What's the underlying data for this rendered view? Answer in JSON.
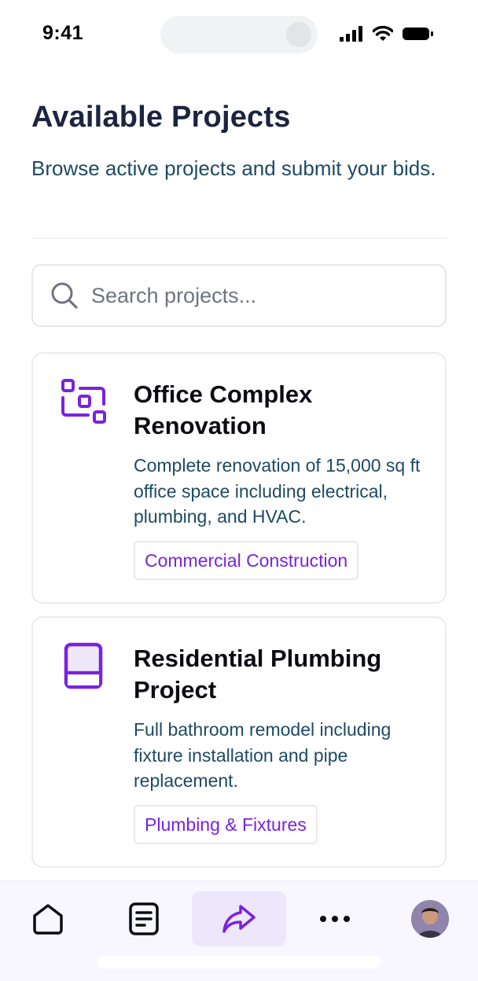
{
  "status_bar": {
    "time": "9:41"
  },
  "header": {
    "title": "Available Projects",
    "subtitle": "Browse active projects and submit your bids."
  },
  "search": {
    "placeholder": "Search projects...",
    "value": ""
  },
  "projects": [
    {
      "title": "Office Complex Renovation",
      "description": "Complete renovation of 15,000 sq ft office space including electrical, plumbing, and HVAC.",
      "category": "Commercial Construction",
      "icon": "layout-blocks-icon"
    },
    {
      "title": "Residential Plumbing Project",
      "description": "Full bathroom remodel including fixture installation and pipe replacement.",
      "category": "Plumbing & Fixtures",
      "icon": "book-icon"
    }
  ],
  "bottom_nav": {
    "items": [
      "home-icon",
      "document-icon",
      "share-arrow-icon",
      "more-icon",
      "avatar"
    ],
    "active_index": 2
  },
  "colors": {
    "accent": "#7a22e0",
    "title": "#1b2440",
    "body_text": "#1e4a63",
    "nav_background": "#f8f7ff",
    "nav_active": "#ece7fb"
  }
}
